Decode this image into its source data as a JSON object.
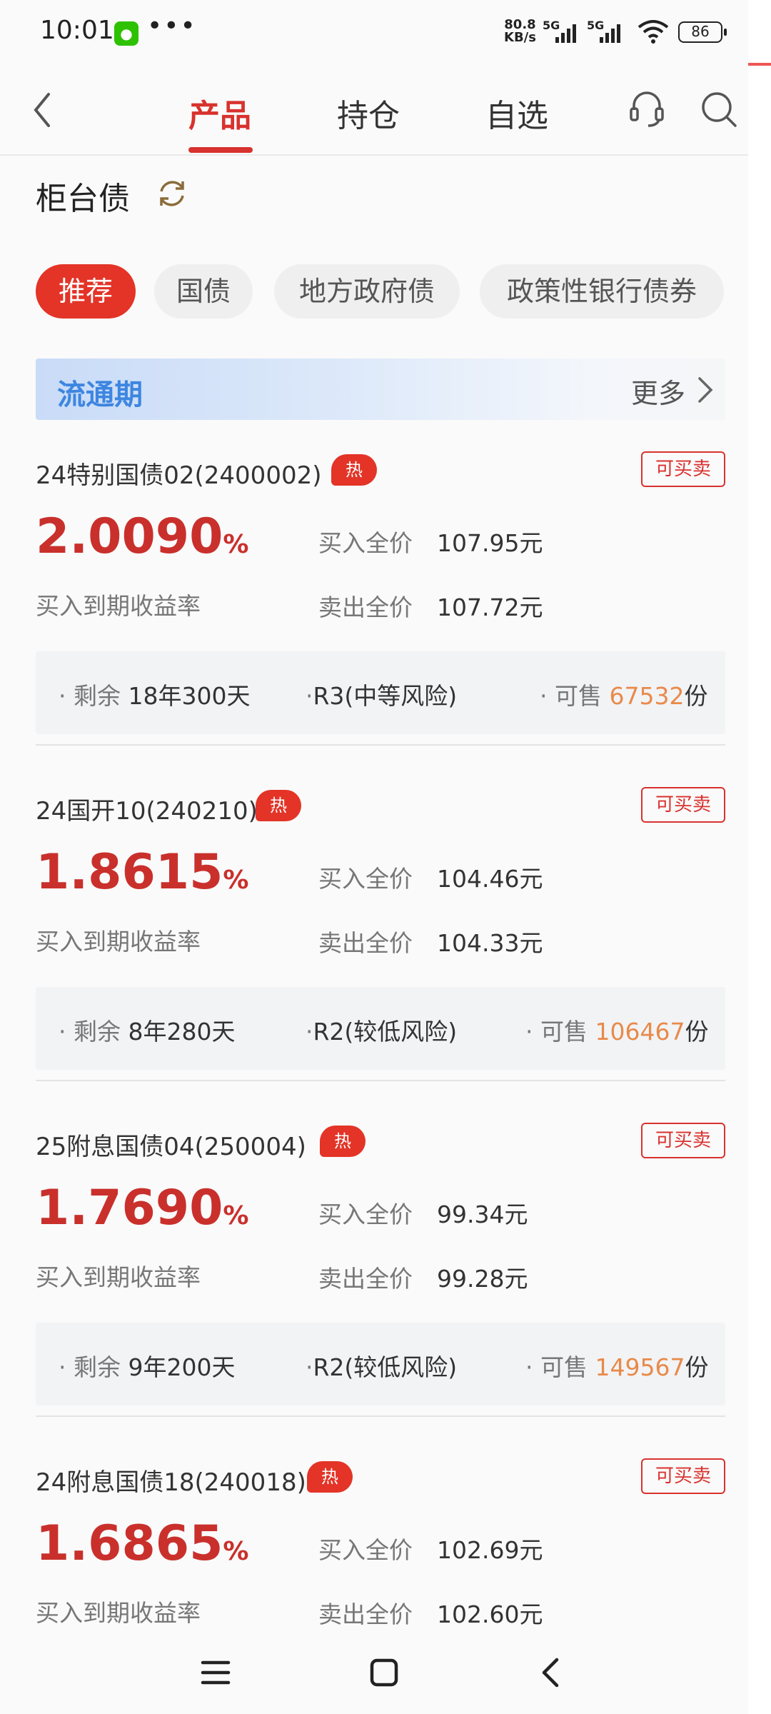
{
  "status_bar": {
    "time": "10:01",
    "dots": "•••",
    "speed_top": "80.8",
    "speed_bottom": "KB/s",
    "net1": "5G",
    "net2": "5G",
    "battery": "86"
  },
  "header": {
    "tabs": [
      {
        "label": "产品",
        "active": true
      },
      {
        "label": "持仓",
        "active": false
      },
      {
        "label": "自选",
        "active": false
      }
    ]
  },
  "page_title": "柜台债",
  "chips": [
    {
      "label": "推荐",
      "active": true
    },
    {
      "label": "国债",
      "active": false
    },
    {
      "label": "地方政府债",
      "active": false
    },
    {
      "label": "政策性银行债券",
      "active": false
    }
  ],
  "section": {
    "title": "流通期",
    "more_label": "更多"
  },
  "labels": {
    "hot": "热",
    "tradeable": "可买卖",
    "yield_label": "买入到期收益率",
    "buy_price_label": "买入全价",
    "sell_price_label": "卖出全价",
    "remaining_label": "剩余",
    "available_label": "可售",
    "unit_share": "份",
    "pct": "%"
  },
  "bonds": [
    {
      "name": "24特别国债02(2400002)",
      "yield": "2.0090",
      "buy_price": "107.95元",
      "sell_price": "107.72元",
      "remaining": "18年300天",
      "risk": "R3(中等风险)",
      "available": "67532"
    },
    {
      "name": "24国开10(240210)",
      "yield": "1.8615",
      "buy_price": "104.46元",
      "sell_price": "104.33元",
      "remaining": "8年280天",
      "risk": "R2(较低风险)",
      "available": "106467"
    },
    {
      "name": "25附息国债04(250004)",
      "yield": "1.7690",
      "buy_price": "99.34元",
      "sell_price": "99.28元",
      "remaining": "9年200天",
      "risk": "R2(较低风险)",
      "available": "149567"
    },
    {
      "name": "24附息国债18(240018)",
      "yield": "1.6865",
      "buy_price": "102.69元",
      "sell_price": "102.60元"
    }
  ],
  "colors": {
    "accent_red": "#d8322e",
    "yield_red": "#c9302c",
    "orange": "#e88a4a",
    "banner_blue": "#3d86e0"
  }
}
